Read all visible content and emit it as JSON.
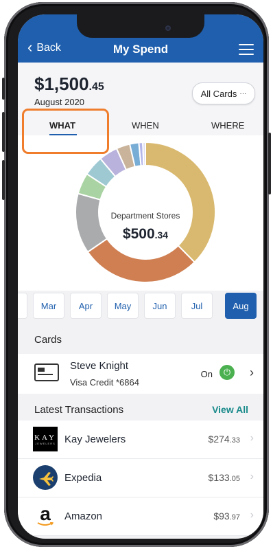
{
  "header": {
    "back_label": "Back",
    "title": "My Spend"
  },
  "summary": {
    "amount_main": "$1,500",
    "amount_cents": ".45",
    "month": "August 2020",
    "filter_label": "All Cards",
    "filter_suffix": "···"
  },
  "tabs": [
    {
      "label": "WHAT",
      "active": true
    },
    {
      "label": "WHEN",
      "active": false
    },
    {
      "label": "WHERE",
      "active": false
    }
  ],
  "chart_data": {
    "type": "pie",
    "center_label": "Department Stores",
    "center_value_main": "$500",
    "center_value_cents": ".34",
    "slices": [
      {
        "value": 500.34,
        "color": "#d9b96f"
      },
      {
        "value": 370,
        "color": "#cf7f52"
      },
      {
        "value": 185,
        "color": "#a9abad"
      },
      {
        "value": 65,
        "color": "#a9d3a2"
      },
      {
        "value": 62,
        "color": "#9ec9d3"
      },
      {
        "value": 58,
        "color": "#b9b2dc"
      },
      {
        "value": 42,
        "color": "#c9b39a"
      },
      {
        "value": 28,
        "color": "#78add6"
      },
      {
        "value": 12,
        "color": "#b4b6ea"
      },
      {
        "value": 8,
        "color": "#dcdcf2"
      }
    ]
  },
  "months": [
    {
      "label": "Mar"
    },
    {
      "label": "Apr"
    },
    {
      "label": "May"
    },
    {
      "label": "Jun"
    },
    {
      "label": "Jul"
    },
    {
      "label": "Aug",
      "active": true
    }
  ],
  "cards": {
    "title": "Cards",
    "items": [
      {
        "name": "Steve Knight",
        "sub": "Visa Credit *6864",
        "status": "On"
      }
    ]
  },
  "transactions": {
    "title": "Latest Transactions",
    "view_all": "View All",
    "items": [
      {
        "name": "Kay Jewelers",
        "amount_main": "$274",
        "amount_cents": ".33",
        "logo": "kay-logo",
        "logo_text": "KAY",
        "logo_sub": "JEWELERS"
      },
      {
        "name": "Expedia",
        "amount_main": "$133",
        "amount_cents": ".05",
        "logo": "expedia-logo"
      },
      {
        "name": "Amazon",
        "amount_main": "$93",
        "amount_cents": ".97",
        "logo": "amazon-logo",
        "logo_text": "a"
      }
    ]
  }
}
